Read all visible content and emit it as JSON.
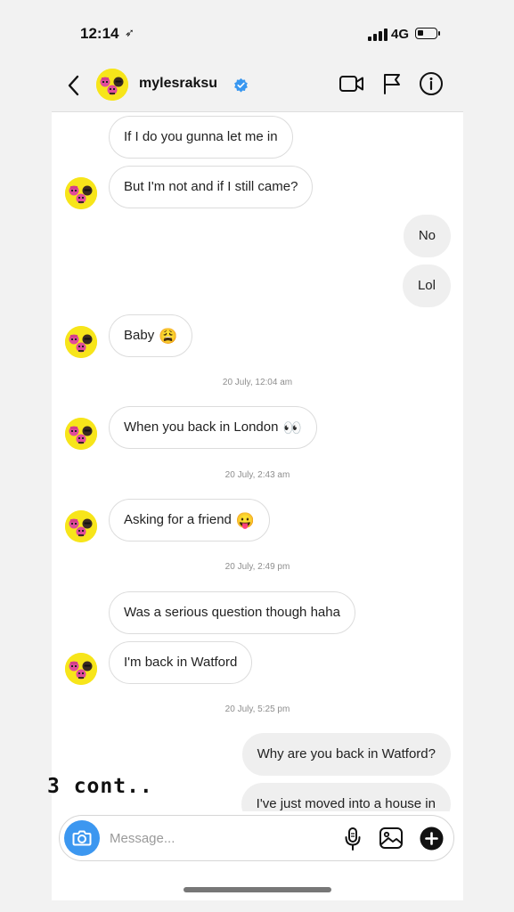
{
  "status_bar": {
    "time": "12:14",
    "location_glyph": "➶",
    "network": "4G",
    "battery_level": 0.35
  },
  "header": {
    "username": "mylesraksu",
    "verified": true
  },
  "icons": {
    "back": "chevron-left-icon",
    "video": "video-camera-icon",
    "flag": "flag-icon",
    "info": "info-icon",
    "camera": "camera-icon",
    "mic": "microphone-icon",
    "gallery": "gallery-icon",
    "plus": "plus-icon"
  },
  "colors": {
    "accent": "#3c97f0",
    "verified": "#3897f0",
    "avatar_bg": "#f7e51a",
    "outgoing_bubble": "#efefef"
  },
  "messages": [
    {
      "direction": "in",
      "text": "If I do you gunna let me in"
    },
    {
      "direction": "in",
      "text": "But I'm not and if I still came?"
    },
    {
      "direction": "out",
      "text": "No"
    },
    {
      "direction": "out",
      "text": "Lol"
    },
    {
      "direction": "in",
      "text": "Baby",
      "emoji": "😩"
    },
    {
      "timestamp": "20 July, 12:04 am"
    },
    {
      "direction": "in",
      "text": "When you back in London",
      "emoji": "👀"
    },
    {
      "timestamp": "20 July, 2:43 am"
    },
    {
      "direction": "in",
      "text": "Asking for a friend",
      "emoji": "😛"
    },
    {
      "timestamp": "20 July, 2:49 pm"
    },
    {
      "direction": "in",
      "text": "Was a serious question though haha"
    },
    {
      "direction": "in",
      "text": "I'm back in Watford"
    },
    {
      "timestamp": "20 July, 5:25 pm"
    },
    {
      "direction": "out",
      "text": "Why are you back in Watford?"
    },
    {
      "direction": "out",
      "text": "I've just moved into a house in"
    }
  ],
  "overlay_text": "3 cont..",
  "composer": {
    "placeholder": "Message..."
  }
}
